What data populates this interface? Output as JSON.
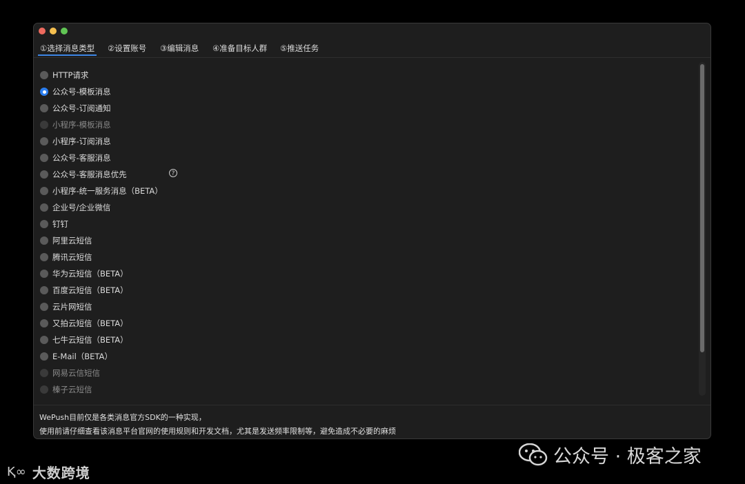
{
  "tabs": [
    {
      "label": "①选择消息类型",
      "active": true
    },
    {
      "label": "②设置账号",
      "active": false
    },
    {
      "label": "③编辑消息",
      "active": false
    },
    {
      "label": "④准备目标人群",
      "active": false
    },
    {
      "label": "⑤推送任务",
      "active": false
    }
  ],
  "options": [
    {
      "label": "HTTP请求",
      "checked": false,
      "disabled": false
    },
    {
      "label": "公众号-模板消息",
      "checked": true,
      "disabled": false
    },
    {
      "label": "公众号-订阅通知",
      "checked": false,
      "disabled": false
    },
    {
      "label": "小程序-模板消息",
      "checked": false,
      "disabled": true
    },
    {
      "label": "小程序-订阅消息",
      "checked": false,
      "disabled": false
    },
    {
      "label": "公众号-客服消息",
      "checked": false,
      "disabled": false
    },
    {
      "label": "公众号-客服消息优先",
      "checked": false,
      "disabled": false
    },
    {
      "label": "小程序-统一服务消息（BETA）",
      "checked": false,
      "disabled": false
    },
    {
      "label": "企业号/企业微信",
      "checked": false,
      "disabled": false
    },
    {
      "label": "钉钉",
      "checked": false,
      "disabled": false
    },
    {
      "label": "阿里云短信",
      "checked": false,
      "disabled": false
    },
    {
      "label": "腾讯云短信",
      "checked": false,
      "disabled": false
    },
    {
      "label": "华为云短信（BETA）",
      "checked": false,
      "disabled": false
    },
    {
      "label": "百度云短信（BETA）",
      "checked": false,
      "disabled": false
    },
    {
      "label": "云片网短信",
      "checked": false,
      "disabled": false
    },
    {
      "label": "又拍云短信（BETA）",
      "checked": false,
      "disabled": false
    },
    {
      "label": "七牛云短信（BETA）",
      "checked": false,
      "disabled": false
    },
    {
      "label": "E-Mail（BETA）",
      "checked": false,
      "disabled": false
    },
    {
      "label": "网易云信短信",
      "checked": false,
      "disabled": true
    },
    {
      "label": "榛子云短信",
      "checked": false,
      "disabled": true
    }
  ],
  "help_icon": "?",
  "footer": {
    "line1": "WePush目前仅是各类消息官方SDK的一种实现，",
    "line2": "使用前请仔细查看该消息平台官网的使用规则和开发文档，尤其是发送频率限制等，避免造成不必要的麻烦"
  },
  "watermarks": {
    "bottom_left_logo": "Ⱪ∞",
    "bottom_left": "大数跨境",
    "bottom_right": "公众号 · 极客之家"
  },
  "colors": {
    "accent": "#2b7ef0",
    "window_bg": "#1e1e1e"
  }
}
